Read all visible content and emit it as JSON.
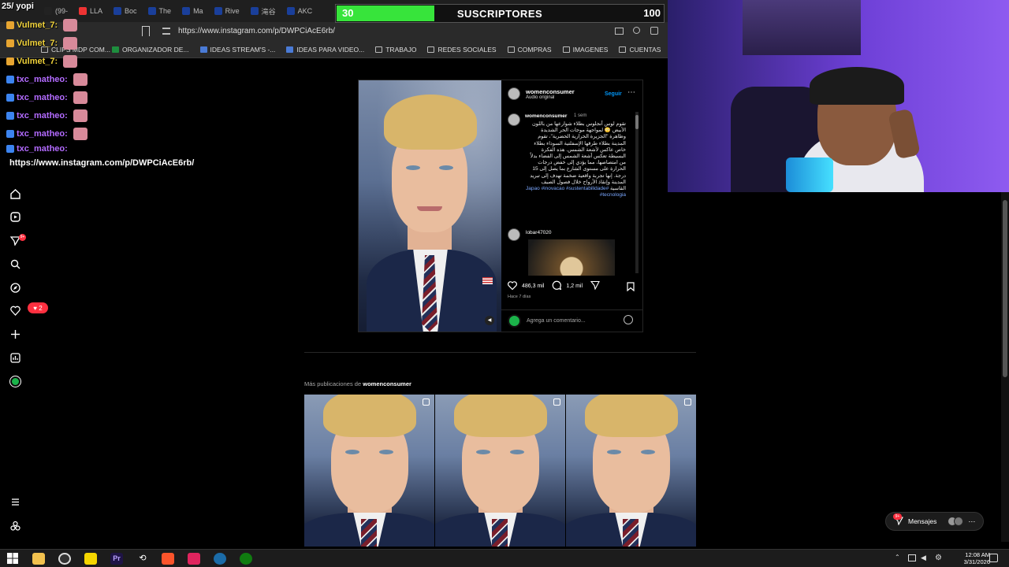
{
  "browser": {
    "tabs": [
      {
        "label": "(99-",
        "color": "#222"
      },
      {
        "label": "LLA",
        "color": "#e33"
      },
      {
        "label": "Boc",
        "color": "#1a3f9a"
      },
      {
        "label": "The",
        "color": "#1a3f9a"
      },
      {
        "label": "Ma",
        "color": "#1a3f9a"
      },
      {
        "label": "Rive",
        "color": "#1a3f9a"
      },
      {
        "label": "滝谷",
        "color": "#1a3f9a"
      },
      {
        "label": "AKC",
        "color": "#1a3f9a"
      }
    ],
    "url": "https://www.instagram.com/p/DWPCiAcE6rb/",
    "bookmarks": [
      {
        "label": "CLIPS MDP COM...",
        "icon": "bookmark"
      },
      {
        "label": "ORGANIZADOR DE...",
        "icon": "sheets"
      },
      {
        "label": "IDEAS STREAM'S -...",
        "icon": "docs"
      },
      {
        "label": "IDEAS PARA VIDEO...",
        "icon": "docs"
      },
      {
        "label": "TRABAJO",
        "icon": "folder"
      },
      {
        "label": "REDES SOCIALES",
        "icon": "folder"
      },
      {
        "label": "COMPRAS",
        "icon": "folder"
      },
      {
        "label": "IMAGENES",
        "icon": "folder"
      },
      {
        "label": "CUENTAS",
        "icon": "folder"
      },
      {
        "label": "IA",
        "icon": "folder"
      }
    ]
  },
  "sub_goal": {
    "current": "30",
    "label": "SUSCRIPTORES",
    "goal": "100",
    "progress": 0.3,
    "color": "#37e43b"
  },
  "chat": {
    "header": "25/ yopi",
    "lines": [
      {
        "user": "Vulmet_7:",
        "color": "#f0d23a"
      },
      {
        "user": "Vulmet_7:",
        "color": "#f0d23a"
      },
      {
        "user": "Vulmet_7:",
        "color": "#f0d23a"
      },
      {
        "user": "txc_matheo:",
        "color": "#b36bff"
      },
      {
        "user": "txc_matheo:",
        "color": "#b36bff"
      },
      {
        "user": "txc_matheo:",
        "color": "#b36bff"
      },
      {
        "user": "txc_matheo:",
        "color": "#b36bff"
      },
      {
        "user": "txc_matheo:",
        "color": "#b36bff"
      }
    ],
    "posted_url": "https://www.instagram.com/p/DWPCiAcE6rb/"
  },
  "nav": {
    "items": [
      "home-icon",
      "reels-icon",
      "direct-icon",
      "search-icon",
      "explore-icon",
      "notifications-icon",
      "create-icon",
      "dashboard-icon",
      "profile-icon"
    ],
    "notifications_badge": "2",
    "direct_badge": "9+",
    "menu": "menu-icon",
    "threads": "threads-icon"
  },
  "post": {
    "username": "womenconsumer",
    "audio": "Audio original",
    "follow": "Seguir",
    "caption_user": "womenconsumer",
    "caption_time": "1 sem",
    "caption": "تقوم لوس أنجلوس بطلاء شوارعها من باللون الأبيض 😳\nلمواجهة موجات الحر الشديدة وظاهرة \"الجزيرة الحرارية الحضرية\"، تقوم المدينة بطلاء طرقها الإسفلتية السوداء بطلاء خاص عاكس لأشعة الشمس. هذه الفكرة البسيطة تعكس أشعة الشمس إلى الفضاء بدلاً من امتصاصها، مما يؤدي إلى خفض درجات الحرارة على مستوى الشارع بما يصل إلى 15 درجة. إنها تجربة واقعية ضخمة تهدف إلى تبريد المدينة وإنقاذ الأرواح خلال فصول الصيف القاسية",
    "hashtags": "#Japao #inovacao #sustentabilidade #tecnologia",
    "commenter": "lobar47020",
    "likes": "486,3 mil",
    "comments": "1,2 mil",
    "posted": "Hace 7 días",
    "comment_placeholder": "Agrega un comentario..."
  },
  "more": {
    "prefix": "Más publicaciones de",
    "user": "womenconsumer"
  },
  "messages": {
    "label": "Mensajes",
    "badge": "9+"
  },
  "clock": {
    "time": "12:08 AM",
    "date": "3/31/2026"
  },
  "colors": {
    "ig_blue": "#0095f6",
    "notif_red": "#ff3040",
    "webcam_purple": "#6d3fd6"
  }
}
